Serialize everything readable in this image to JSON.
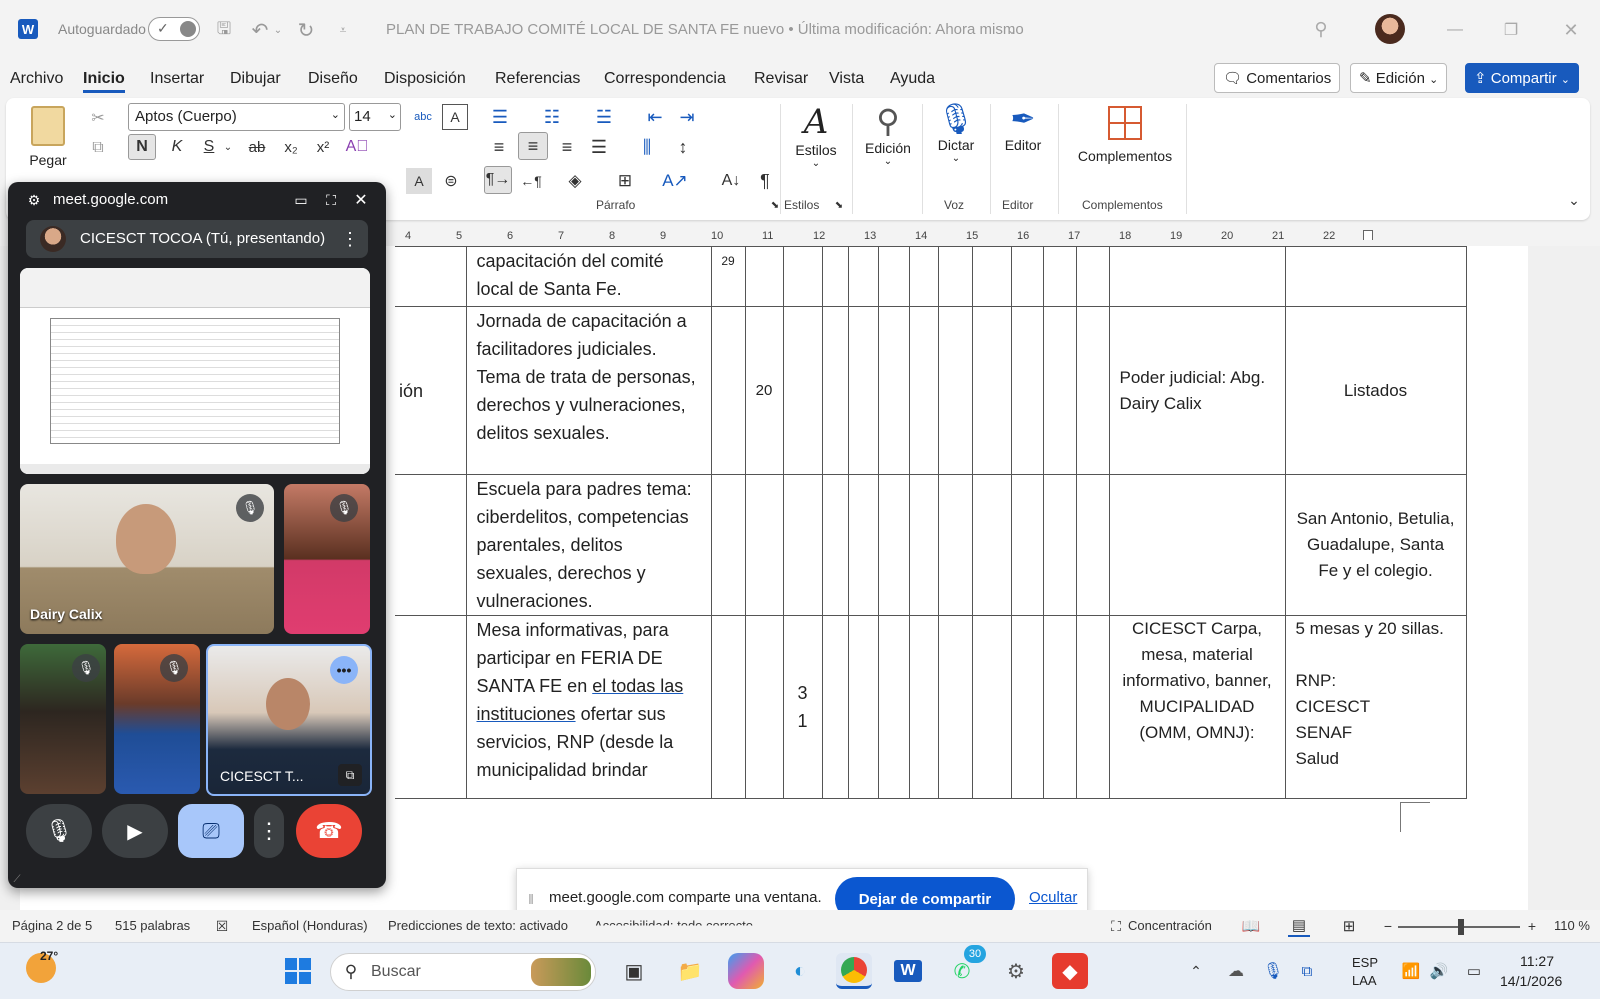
{
  "titlebar": {
    "autosave_label": "Autoguardado",
    "doc_title": "PLAN DE TRABAJO COMITÉ LOCAL DE SANTA FE nuevo • Última modificación: Ahora mismo"
  },
  "menu": {
    "tabs": [
      "Archivo",
      "Inicio",
      "Insertar",
      "Dibujar",
      "Diseño",
      "Disposición",
      "Referencias",
      "Correspondencia",
      "Revisar",
      "Vista",
      "Ayuda"
    ],
    "comments": "Comentarios",
    "editing": "Edición",
    "share": "Compartir"
  },
  "ribbon": {
    "paste": "Pegar",
    "font_name": "Aptos (Cuerpo)",
    "font_size": "14",
    "bold": "N",
    "italic": "K",
    "underline": "S",
    "paragraph": "Párrafo",
    "styles": "Estilos",
    "styles_group": "Estilos",
    "edit": "Edición",
    "dictate": "Dictar",
    "voice": "Voz",
    "editor": "Editor",
    "editor_group": "Editor",
    "addins": "Complementos",
    "addins_group": "Complementos"
  },
  "ruler": [
    "4",
    "5",
    "6",
    "7",
    "8",
    "9",
    "10",
    "11",
    "12",
    "13",
    "14",
    "15",
    "16",
    "17",
    "18",
    "19",
    "20",
    "21",
    "22"
  ],
  "table": {
    "row1": {
      "activity": "capacitación del comité local de Santa Fe.",
      "num": "29"
    },
    "row2": {
      "left": "ión",
      "activity": "Jornada de capacitación a facilitadores judiciales. Tema de trata de personas, derechos y vulneraciones, delitos sexuales.",
      "num": "20",
      "resp": "Poder judicial: Abg. Dairy Calix",
      "verif": "Listados"
    },
    "row3": {
      "activity": "Escuela para padres tema: ciberdelitos, competencias parentales, delitos sexuales, derechos y vulneraciones.",
      "verif": "San Antonio, Betulia, Guadalupe, Santa Fe y el colegio."
    },
    "row4": {
      "activity_a": "Mesa informativas, para participar en FERIA DE SANTA FE en ",
      "activity_link": "el todas las instituciones",
      "activity_b": " ofertar sus servicios, RNP (desde la municipalidad brindar",
      "num": "3 1",
      "resp": "CICESCT Carpa, mesa, material informativo, banner, MUCIPALIDAD (OMM, OMNJ):",
      "verif": "5 mesas y 20 sillas.\n\nRNP:\nCICESCT\nSENAF\nSalud"
    }
  },
  "meet": {
    "url": "meet.google.com",
    "presenter": "CICESCT TOCOA (Tú, presentando)",
    "tile_dairy": "Dairy Calix",
    "tile_self": "CICESCT T..."
  },
  "share_bar": {
    "message": "meet.google.com comparte una ventana.",
    "stop": "Dejar de compartir",
    "hide": "Ocultar"
  },
  "status": {
    "page": "Página 2 de 5",
    "words": "515 palabras",
    "language": "Español (Honduras)",
    "predictions": "Predicciones de texto: activado",
    "accessibility": "Accesibilidad: todo correcto",
    "focus": "Concentración",
    "zoom": "110 %"
  },
  "taskbar": {
    "weather": "27°",
    "search": "Buscar",
    "whatsapp_badge": "30",
    "lang1": "ESP",
    "lang2": "LAA",
    "time": "11:27",
    "date": "14/1/2026"
  },
  "colors": {
    "accent": "#0f6cbd",
    "word_blue": "#185abd",
    "meet_bg": "#202124",
    "hangup": "#ea4335",
    "share_blue": "#0b57d0"
  }
}
